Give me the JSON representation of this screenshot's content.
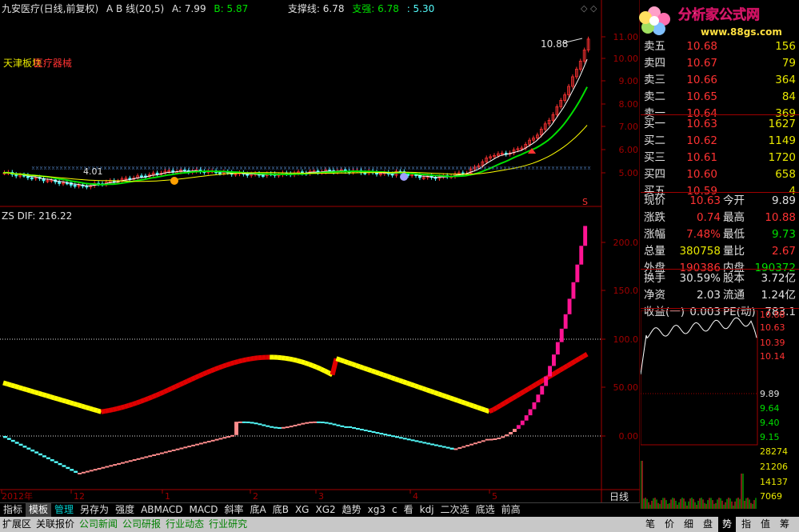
{
  "header": {
    "stock": "九安医疗(日线,前复权)",
    "indicator": "A B 线(20,5)",
    "a_label": "A: 7.99",
    "b_label": "B: 5.87",
    "support": "支撑线: 6.78",
    "strong": "支强: 6.78",
    "extra": ": 5.30"
  },
  "logo": {
    "title": "分析家公式网",
    "url": "www.88gs.com"
  },
  "price_panel": {
    "left_label_1": "天津板块",
    "left_label_2": "医疗器械",
    "high_annot": "10.88",
    "low_annot": "4.01",
    "y_ticks": [
      "11.00",
      "10.00",
      "9.00",
      "8.00",
      "7.00",
      "6.00",
      "5.00"
    ]
  },
  "osc_panel": {
    "label": "ZS  DIF: 216.22",
    "y_ticks": [
      "200.0",
      "150.0",
      "100.0",
      "50.00",
      "0.00"
    ]
  },
  "x_axis": {
    "labels": [
      "2012年",
      "12",
      "1",
      "2",
      "3",
      "4",
      "5"
    ],
    "period": "日线"
  },
  "colors": {
    "up": "#ff3232",
    "down": "#54fcfc",
    "ma_green": "#00e000",
    "yellow": "#ffff00",
    "red": "#e00000",
    "magenta": "#ff1493",
    "pink": "#ff8c8c"
  },
  "quote": {
    "sells": [
      {
        "label": "卖五",
        "price": "10.68",
        "vol": "156"
      },
      {
        "label": "卖四",
        "price": "10.67",
        "vol": "79"
      },
      {
        "label": "卖三",
        "price": "10.66",
        "vol": "364"
      },
      {
        "label": "卖二",
        "price": "10.65",
        "vol": "84"
      },
      {
        "label": "卖一",
        "price": "10.64",
        "vol": "369"
      }
    ],
    "buys": [
      {
        "label": "买一",
        "price": "10.63",
        "vol": "1627"
      },
      {
        "label": "买二",
        "price": "10.62",
        "vol": "1149"
      },
      {
        "label": "买三",
        "price": "10.61",
        "vol": "1720"
      },
      {
        "label": "买四",
        "price": "10.60",
        "vol": "658"
      },
      {
        "label": "买五",
        "price": "10.59",
        "vol": "4"
      }
    ],
    "stats": [
      {
        "l1": "现价",
        "v1": "10.63",
        "c1": "#ff3232",
        "l2": "今开",
        "v2": "9.89",
        "c2": "#e0e0e0"
      },
      {
        "l1": "涨跌",
        "v1": "0.74",
        "c1": "#ff3232",
        "l2": "最高",
        "v2": "10.88",
        "c2": "#ff3232"
      },
      {
        "l1": "涨幅",
        "v1": "7.48%",
        "c1": "#ff3232",
        "l2": "最低",
        "v2": "9.73",
        "c2": "#00e000"
      },
      {
        "l1": "总量",
        "v1": "380758",
        "c1": "#e8e800",
        "l2": "量比",
        "v2": "2.67",
        "c2": "#ff3232"
      },
      {
        "l1": "外盘",
        "v1": "190386",
        "c1": "#ff3232",
        "l2": "内盘",
        "v2": "190372",
        "c2": "#00e000"
      }
    ],
    "stats2": [
      {
        "l1": "换手",
        "v1": "30.59%",
        "c1": "#e0e0e0",
        "l2": "股本",
        "v2": "3.72亿",
        "c2": "#e0e0e0"
      },
      {
        "l1": "净资",
        "v1": "2.03",
        "c1": "#e0e0e0",
        "l2": "流通",
        "v2": "1.24亿",
        "c2": "#e0e0e0"
      },
      {
        "l1": "收益(一)",
        "v1": "0.003",
        "c1": "#e0e0e0",
        "l2": "PE(动)",
        "v2": "783.1",
        "c2": "#e0e0e0"
      }
    ],
    "mini_prices": [
      "10.88",
      "10.63",
      "10.39",
      "10.14",
      "9.89",
      "9.64",
      "9.40",
      "9.15"
    ],
    "mini_vols": [
      "28274",
      "21206",
      "14137",
      "7069"
    ]
  },
  "tabs": [
    "指标",
    "模板",
    "管理",
    "另存为",
    "强度",
    "ABMACD",
    "MACD",
    "斜率",
    "底A",
    "底B",
    "XG",
    "XG2",
    "趋势",
    "xg3",
    "c",
    "看",
    "kdj",
    "二次选",
    "底选",
    "前高"
  ],
  "bottom_tabs": [
    "扩展区",
    "关联报价",
    "公司新闻",
    "公司研报",
    "行业动态",
    "行业研究"
  ],
  "right_tabs": [
    "笔",
    "价",
    "细",
    "盘",
    "势",
    "指",
    "值",
    "筹"
  ]
}
